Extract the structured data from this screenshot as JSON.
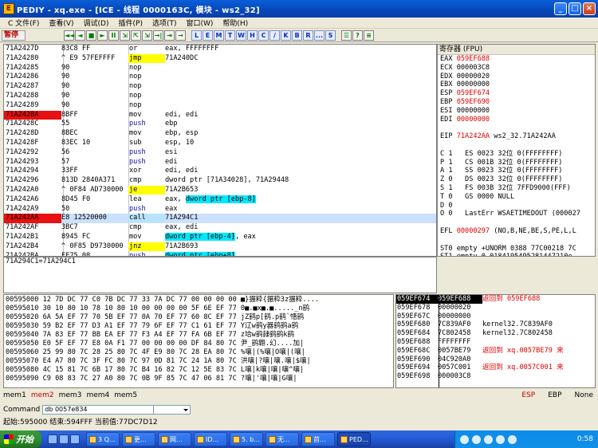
{
  "window": {
    "title": "PEDIY - xq.exe - [ICE - 线程 0000163C, 模块 - ws2_32]",
    "icon": "E"
  },
  "menu": [
    "C 文件(F)",
    "查看(V)",
    "调试(D)",
    "插件(P)",
    "选项(T)",
    "窗口(W)",
    "帮助(H)"
  ],
  "toolbar": {
    "status": "暂停",
    "buttons": [
      "◄◄",
      "◄",
      "■",
      "►",
      "II",
      "⇲",
      "⇱",
      "⇲",
      "→|",
      "⇥",
      "→"
    ],
    "letters": [
      "L",
      "E",
      "M",
      "T",
      "W",
      "H",
      "C",
      "/",
      "K",
      "B",
      "R",
      "...",
      "S"
    ],
    "extras": [
      "☰",
      "?",
      "≡"
    ]
  },
  "disasm": [
    {
      "addr": "71A2427D",
      "hex": "83C8 FF",
      "m": "or",
      "op": "eax, FFFFFFFF"
    },
    {
      "addr": "71A24280",
      "hex": "^ E9 57FEFFFF",
      "m": "jmp",
      "op": "71A240DC",
      "kind": "jmp"
    },
    {
      "addr": "71A24285",
      "hex": "90",
      "m": "nop",
      "op": ""
    },
    {
      "addr": "71A24286",
      "hex": "90",
      "m": "nop",
      "op": ""
    },
    {
      "addr": "71A24287",
      "hex": "90",
      "m": "nop",
      "op": ""
    },
    {
      "addr": "71A24288",
      "hex": "90",
      "m": "nop",
      "op": ""
    },
    {
      "addr": "71A24289",
      "hex": "90",
      "m": "nop",
      "op": ""
    },
    {
      "addr": "71A2428A",
      "hex": "8BFF",
      "m": "mov",
      "op": "edi, edi",
      "bp": true
    },
    {
      "addr": "71A2428C",
      "hex": "55",
      "m": "push",
      "op": "ebp",
      "kind": "push"
    },
    {
      "addr": "71A2428D",
      "hex": "8BEC",
      "m": "mov",
      "op": "ebp, esp"
    },
    {
      "addr": "71A2428F",
      "hex": "83EC 10",
      "m": "sub",
      "op": "esp, 10"
    },
    {
      "addr": "71A24292",
      "hex": "56",
      "m": "push",
      "op": "esi",
      "kind": "push"
    },
    {
      "addr": "71A24293",
      "hex": "57",
      "m": "push",
      "op": "edi",
      "kind": "push"
    },
    {
      "addr": "71A24294",
      "hex": "33FF",
      "m": "xor",
      "op": "edi, edi"
    },
    {
      "addr": "71A24296",
      "hex": "813D 2840A371",
      "m": "cmp",
      "op": "dword ptr [71A34028], 71A29448"
    },
    {
      "addr": "71A242A0",
      "hex": "^ 0F84 AD730000",
      "m": "je",
      "op": "71A2B653",
      "kind": "jmp"
    },
    {
      "addr": "71A242A6",
      "hex": "8D45 F0",
      "m": "lea",
      "op": "eax, dword ptr [ebp-8]",
      "hlop": "dword ptr [ebp-8]",
      "pre": "eax, "
    },
    {
      "addr": "71A242A9",
      "hex": "50",
      "m": "push",
      "op": "eax",
      "kind": "push"
    },
    {
      "addr": "71A242AA",
      "hex": "E8 12520000",
      "m": "call",
      "op": "71A294C1",
      "kind": "call",
      "bp": true,
      "cur": true
    },
    {
      "addr": "71A242AF",
      "hex": "3BC7",
      "m": "cmp",
      "op": "eax, edi"
    },
    {
      "addr": "71A242B1",
      "hex": "8945 FC",
      "m": "mov",
      "op": "dword ptr [ebp-4], eax",
      "hlop": "dword ptr [ebp-4]",
      "post": ", eax"
    },
    {
      "addr": "71A242B4",
      "hex": "^ 0F85 D9730000",
      "m": "jnz",
      "op": "71A2B693",
      "kind": "jmp"
    },
    {
      "addr": "71A242BA",
      "hex": "FF75 08",
      "m": "push",
      "op": "dword ptr [ebp+8]",
      "kind": "push",
      "hlop": "dword ptr [ebp+8]"
    }
  ],
  "info_text": "71A294C1=71A294C1",
  "registers": {
    "title": "寄存器 (FPU)",
    "lines": [
      {
        "t": "EAX ",
        "v": "059EF688",
        "red": true
      },
      {
        "t": "ECX 000003C8"
      },
      {
        "t": "EDX 00000020"
      },
      {
        "t": "EBX 00000000"
      },
      {
        "t": "ESP ",
        "v": "059EF674",
        "red": true
      },
      {
        "t": "EBP ",
        "v": "059EF690",
        "red": true
      },
      {
        "t": "ESI 00000000"
      },
      {
        "t": "EDI ",
        "v": "00000000",
        "red": true
      },
      {
        "t": ""
      },
      {
        "t": "EIP ",
        "v": "71A242AA",
        "red": true,
        "tail": " ws2_32.71A242AA"
      },
      {
        "t": ""
      },
      {
        "t": "C 1   ES 0023 32位 0(FFFFFFFF)",
        "redflag": "1"
      },
      {
        "t": "P 1   CS 001B 32位 0(FFFFFFFF)",
        "redflag": "1"
      },
      {
        "t": "A 1   SS 0023 32位 0(FFFFFFFF)",
        "redflag": "1"
      },
      {
        "t": "Z 0   DS 0023 32位 0(FFFFFFFF)"
      },
      {
        "t": "S 1   FS 003B 32位 7FFD9000(FFF)",
        "redflag": "1"
      },
      {
        "t": "T 0   GS 0000 NULL"
      },
      {
        "t": "D 0"
      },
      {
        "t": "O 0   LastErr WSAETIMEDOUT (000027"
      },
      {
        "t": ""
      },
      {
        "t": "EFL ",
        "v": "00000297",
        "red": true,
        "tail": " (NO,B,NE,BE,S,PE,L,L"
      },
      {
        "t": ""
      },
      {
        "t": "ST0 empty +UNORM 0388 77C00218 7C"
      },
      {
        "t": "ST1 empty 0.0184195495281447210e-"
      },
      {
        "t": "ST2 empty +UNORM 001D 77C002FC 00"
      },
      {
        "t": "ST3 empty +UNORM 7EB4 0000001D 00"
      },
      {
        "t": "ST4 empty +UNORM 6165 62613531 00"
      },
      {
        "t": "ST5 empty +UNORM 3733 2E37322E 33"
      }
    ]
  },
  "dump": [
    "00595000 12 7D DC 77 C0 7B DC 77 33 7A DC 77 00 00 00 00 ■}搌粋{搌粋3z搌粋....",
    "00595010 30 10 80 10 78 10 80 10 00 00 00 00 5F 6E EF 77 0■.■x■.■....._n鹞",
    "00595020 6A 5A EF 77 70 5B EF 77 0A 70 EF 77 60 8C EF 77 jZ鹞p[鹞.p鹞`啎鹞",
    "00595030 59 B2 EF 77 D3 A1 EF 77 79 6F EF 77 C1 61 EF 77 Y辽w鹞y器鹞鹞a鹞",
    "00595040 7A 83 EF 77 BB EA EF 77 F3 A4 EF 77 FA 6B EF 77 z垥w鹞隷鹞鹞k鹞",
    "00595050 E0 5F EF 77 E8 0A F1 77 00 00 00 00 DF 84 80 7C 尹_鹞翺.幻....加|",
    "00595060 25 99 80 7C 28 25 80 7C 4F E9 80 7C 28 EA 80 7C %嚷|(%嚷|O嚷|(嚷|",
    "00595070 E4 A7 80 7C 3F FC 80 7C 97 0D 81 7C 24 1A 80 7C 洪嚷|?嚷|嚷.嚷|$嚷|",
    "00595080 4C 15 81 7C 6B 17 80 7C B4 16 82 7C 12 5E 83 7C L嚷|k嚷|嚷|嚷^嚷|",
    "00595090 C9 08 83 7C 27 A0 80 7C 0B 9F 85 7C 47 06 81 7C ?嚷|'嚷|嚷|G嚷|"
  ],
  "stack": [
    {
      "a": "059EF674",
      "v": "059EF688",
      "c": "返回到 059EF688",
      "sel": true,
      "red": true
    },
    {
      "a": "059EF678",
      "v": "00000020",
      "c": ""
    },
    {
      "a": "059EF67C",
      "v": "00000000",
      "c": ""
    },
    {
      "a": "059EF680",
      "v": "7C839AF0",
      "c": "kernel32.7C839AF0"
    },
    {
      "a": "059EF684",
      "v": "7C802458",
      "c": "kernel32.7C802458"
    },
    {
      "a": "059EF688",
      "v": "FFFFFFFF",
      "c": ""
    },
    {
      "a": "059EF68C",
      "v": "0057BE79",
      "c": "返回到 xq.0057BE79 来",
      "red": true
    },
    {
      "a": "059EF690",
      "v": "04C920A0",
      "c": ""
    },
    {
      "a": "059EF694",
      "v": "0057C001",
      "c": "返回到 xq.0057C001 来",
      "red": true
    },
    {
      "a": "059EF698",
      "v": "000003C8",
      "c": ""
    }
  ],
  "memtabs": [
    "mem1",
    "mem2",
    "mem3",
    "mem4",
    "mem5"
  ],
  "memright": [
    "ESP",
    "EBP",
    "None"
  ],
  "command": {
    "label": "Command",
    "value": "db 0057e834"
  },
  "statusline": "起始:595000 结束:594FFF 当前值:77DC7D12",
  "taskbar": {
    "start": "开始",
    "tasks": [
      "3 Q...",
      "更...",
      "网...",
      "ID...",
      "5. b...",
      "无...",
      "首...",
      "PED..."
    ],
    "clock": "0:58"
  }
}
